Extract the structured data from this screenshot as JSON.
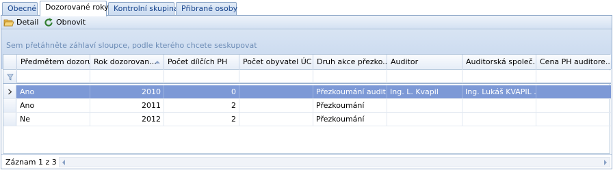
{
  "tabs": [
    {
      "label": "Obecné",
      "active": false
    },
    {
      "label": "Dozorované roky",
      "active": true
    },
    {
      "label": "Kontrolní skupina",
      "active": false
    },
    {
      "label": "Přibrané osoby",
      "active": false
    }
  ],
  "toolbar": {
    "detail_label": "Detail",
    "refresh_label": "Obnovit",
    "detail_icon": "folder-open-icon",
    "refresh_icon": "refresh-icon"
  },
  "group_panel": {
    "text": "Sem přetáhněte záhlaví sloupce, podle kterého chcete seskupovat"
  },
  "grid": {
    "columns": [
      "Předmětem dozoru",
      "Rok dozorovan...",
      "Počet dílčích PH",
      "Počet obyvatel ÚC",
      "Druh akce přezko...",
      "Auditor",
      "Auditorská společ...",
      "Cena PH auditore..."
    ],
    "sorted_column": "Rok dozorovan...",
    "sort_direction": "ascending",
    "rows": [
      {
        "selected": true,
        "cells": [
          "Ano",
          "2010",
          "0",
          "",
          "Přezkoumání audit...",
          "Ing. L. Kvapil",
          "Ing. Lukáš KVAPIL ...",
          ""
        ]
      },
      {
        "selected": false,
        "cells": [
          "Ano",
          "2011",
          "2",
          "",
          "Přezkoumání",
          "",
          "",
          ""
        ]
      },
      {
        "selected": false,
        "cells": [
          "Ne",
          "2012",
          "2",
          "",
          "Přezkoumání",
          "",
          "",
          ""
        ]
      }
    ]
  },
  "footer": {
    "record_text": "Záznam 1 z 3"
  },
  "colors": {
    "selection": "#7d99d6",
    "tab_text": "#15428b",
    "group_text": "#6c8cb6"
  }
}
